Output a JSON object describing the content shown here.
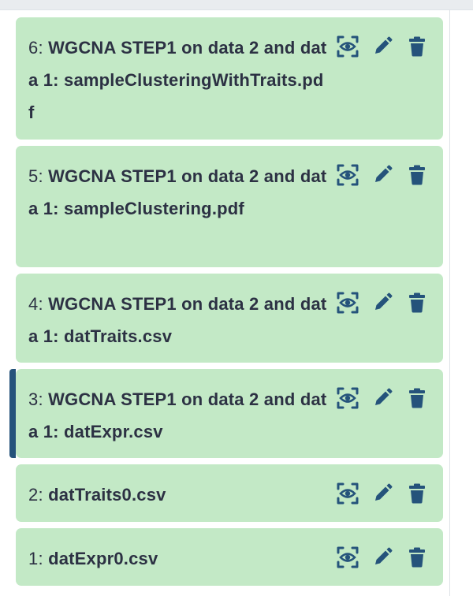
{
  "history": {
    "items": [
      {
        "hid": "6",
        "name": "WGCNA STEP1 on data 2 and data 1: sampleClusteringWithTraits.pdf",
        "current": false
      },
      {
        "hid": "5",
        "name": "WGCNA STEP1 on data 2 and data 1: sampleClustering.pdf",
        "current": false
      },
      {
        "hid": "4",
        "name": "WGCNA STEP1 on data 2 and data 1: datTraits.csv",
        "current": false
      },
      {
        "hid": "3",
        "name": "WGCNA STEP1 on data 2 and data 1: datExpr.csv",
        "current": true
      },
      {
        "hid": "2",
        "name": "datTraits0.csv",
        "current": false
      },
      {
        "hid": "1",
        "name": "datExpr0.csv",
        "current": false
      }
    ],
    "icons": {
      "display": "eye-icon",
      "edit": "pencil-icon",
      "delete": "trash-icon"
    },
    "colors": {
      "item_bg": "#c3e9c6",
      "icon": "#25537b",
      "text": "#2c3143",
      "current_marker": "#25537b"
    }
  }
}
